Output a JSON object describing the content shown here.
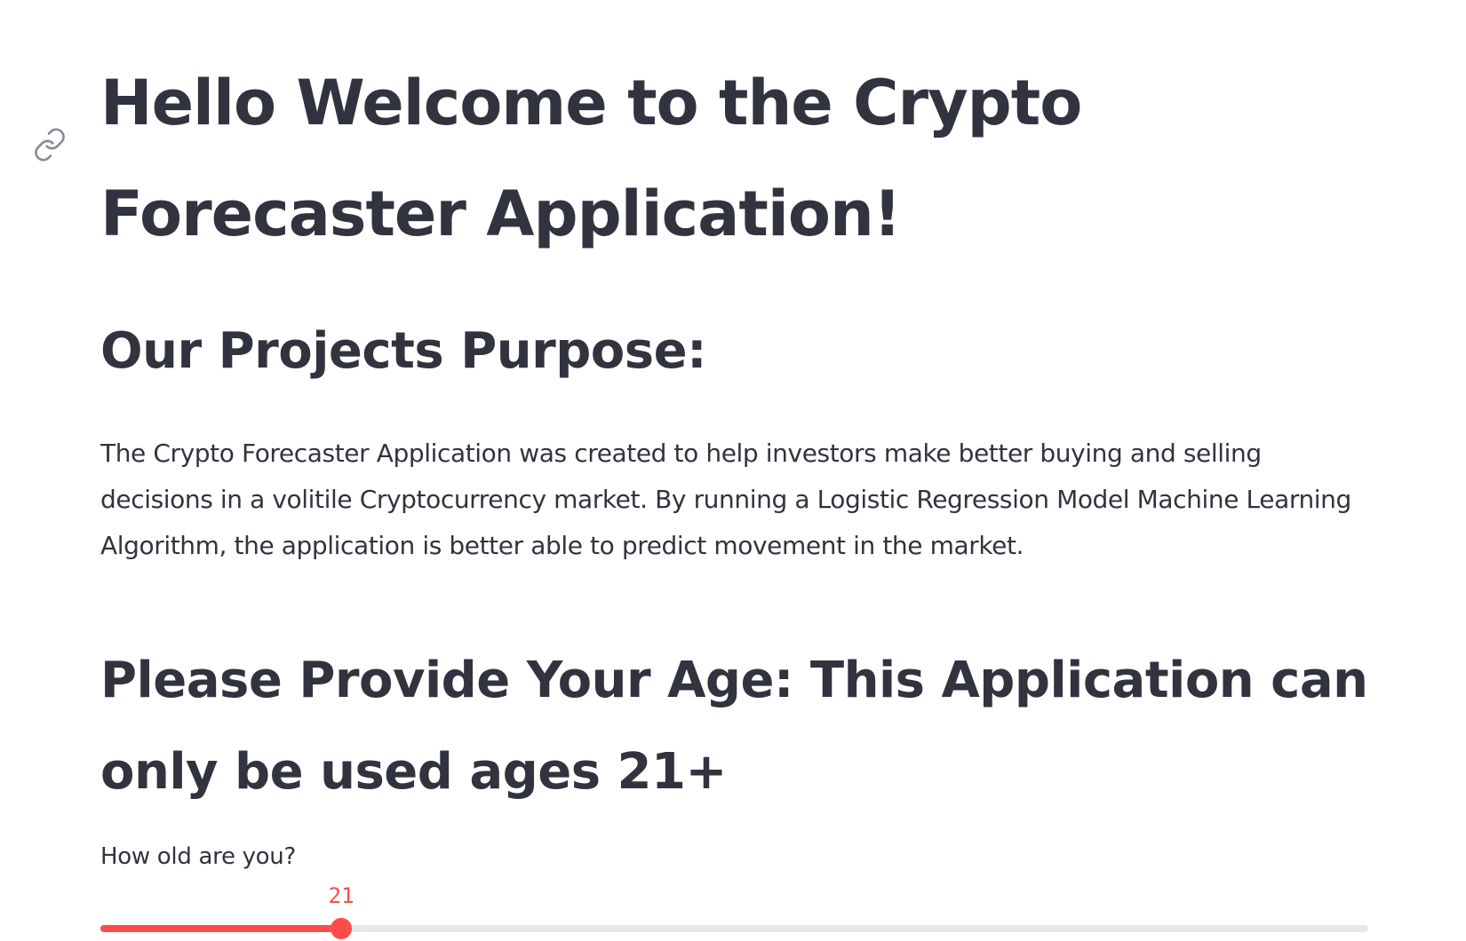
{
  "header": {
    "title": "Hello Welcome to the Crypto Forecaster Application!",
    "anchor_icon": "link-icon"
  },
  "purpose": {
    "heading": "Our Projects Purpose:",
    "text": "The Crypto Forecaster Application was created to help investors make better buying and selling decisions in a volitile Cryptocurrency market. By running a Logistic Regression Model Machine Learning Algorithm, the application is better able to predict movement in the market."
  },
  "age": {
    "heading": "Please Provide Your Age: This Application can only be used ages 21+",
    "slider_label": "How old are you?",
    "slider_value": "21",
    "slider_fraction": 0.19
  },
  "colors": {
    "accent": "#ff4b4b",
    "track": "#e7e8ee",
    "text": "#31333f"
  }
}
